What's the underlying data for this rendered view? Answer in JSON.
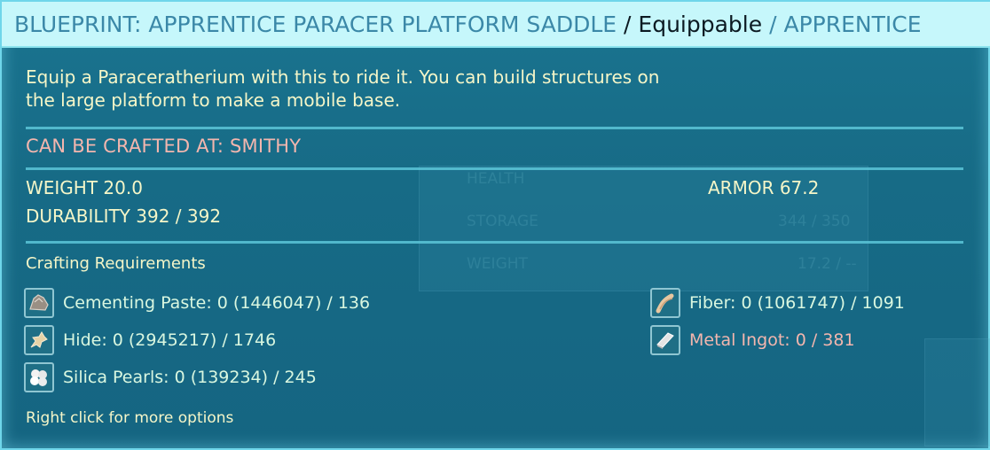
{
  "header": {
    "part1": "BLUEPRINT: APPRENTICE PARACER PLATFORM SADDLE",
    "sep1": " / ",
    "part2": "Equippable",
    "sep2": " / ",
    "part3": "APPRENTICE"
  },
  "description": {
    "line1": "Equip a Paraceratherium with this to ride it. You can build structures on",
    "line2": "the large platform to make a mobile base."
  },
  "crafted_at": "CAN BE CRAFTED AT: SMITHY",
  "stats": {
    "weight": "WEIGHT 20.0",
    "armor": "ARMOR 67.2",
    "durability": "DURABILITY 392 / 392"
  },
  "requirements": {
    "title": "Crafting Requirements",
    "items": [
      {
        "label": "Cementing Paste: 0 (1446047) / 136",
        "icon": "cementing-paste-icon"
      },
      {
        "label": "Hide: 0 (2945217) / 1746",
        "icon": "hide-icon"
      },
      {
        "label": "Silica Pearls: 0 (139234) / 245",
        "icon": "silica-pearls-icon"
      },
      {
        "label": "Fiber: 0 (1061747) / 1091",
        "icon": "fiber-icon"
      },
      {
        "label": "Metal Ingot: 0 / 381",
        "icon": "metal-ingot-icon"
      }
    ]
  },
  "footer": "Right click for more options",
  "background": {
    "health": "HEALTH",
    "storage": "STORAGE",
    "weight": "WEIGHT",
    "storage_val": "344 / 350",
    "weight_val": "17.2 / --"
  },
  "colors": {
    "header_bg": "#c6f7fb",
    "header_blue": "#3b88a8",
    "panel_bg": "#176b86",
    "cream_text": "#f5f6c8",
    "salmon_text": "#f3b6ae",
    "divider": "#5cc6d8"
  }
}
